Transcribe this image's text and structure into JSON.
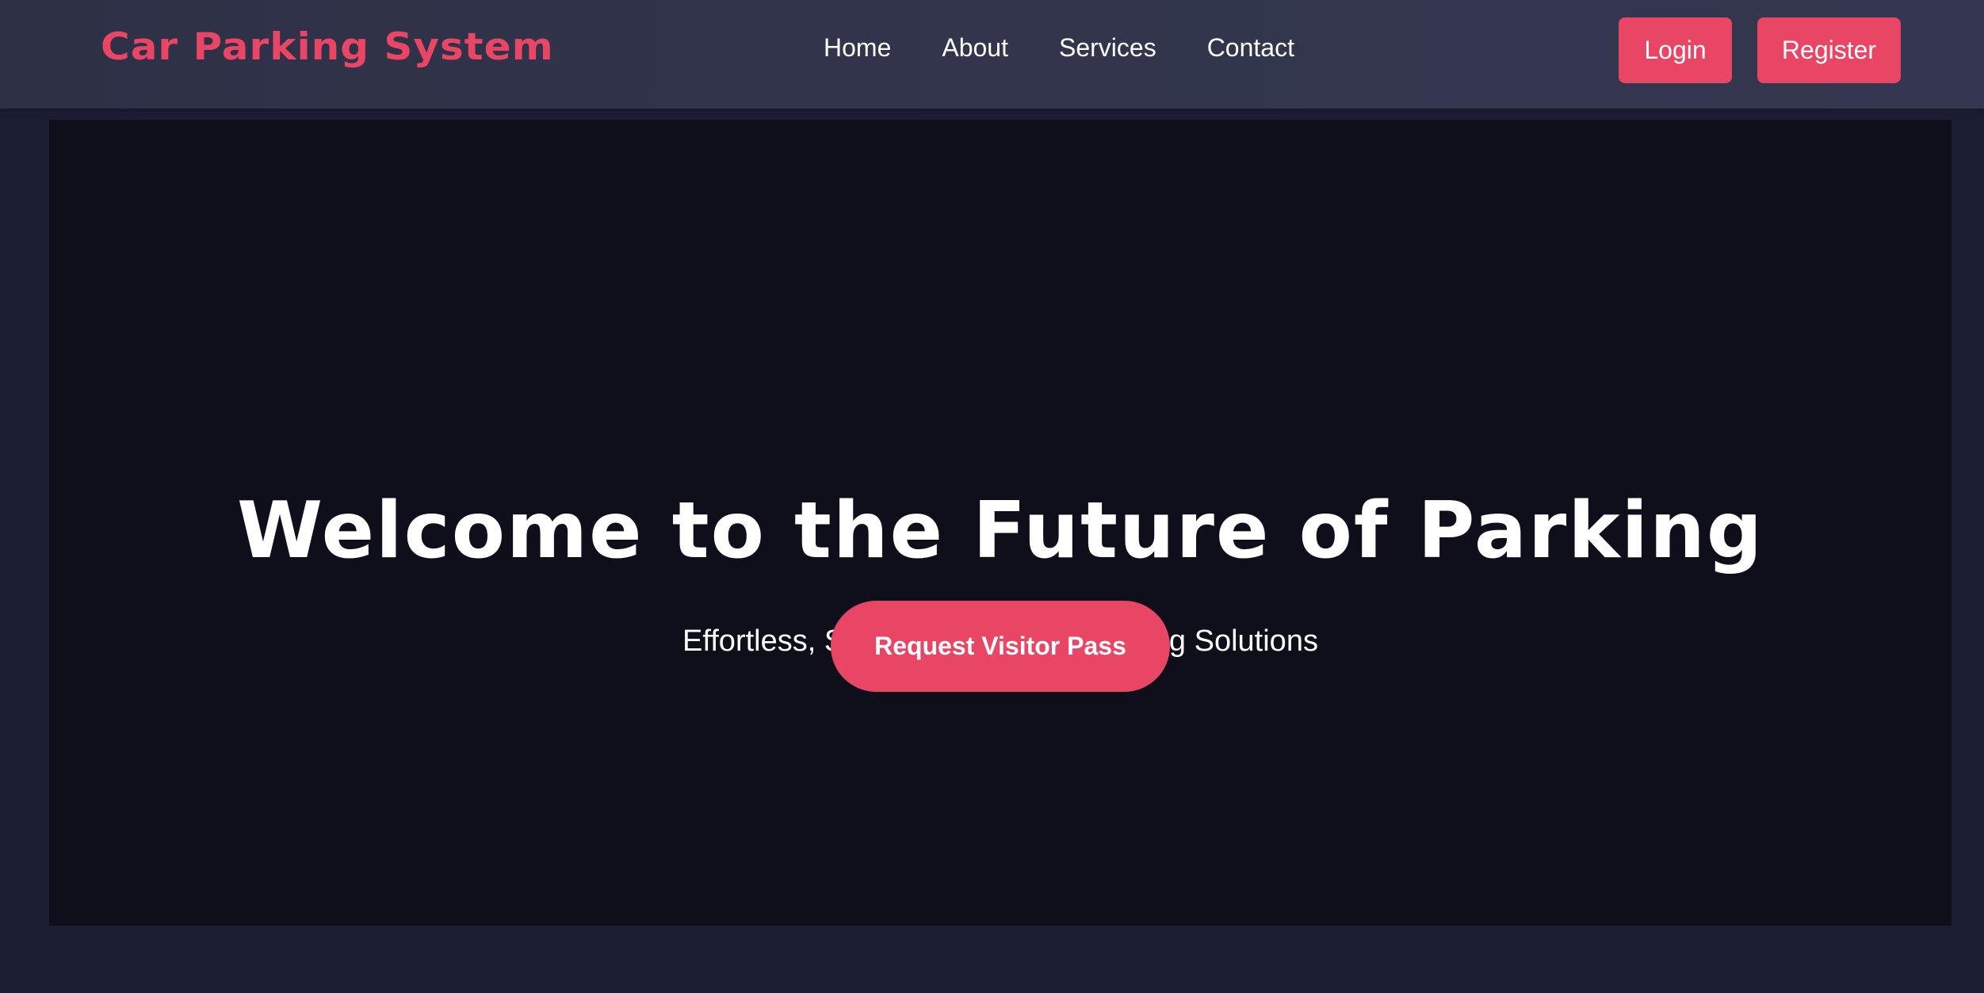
{
  "navbar": {
    "brand": "Car Parking System",
    "links": [
      "Home",
      "About",
      "Services",
      "Contact"
    ],
    "login_label": "Login",
    "register_label": "Register"
  },
  "hero": {
    "title": "Welcome to the Future of Parking",
    "subtitle": "Effortless, Secure, and Smart Parking Solutions",
    "cta_label": "Request Visitor Pass"
  },
  "colors": {
    "accent": "#e84664",
    "navbar": "#32354c",
    "background": "#1b1d33",
    "hero_background": "#0e0f1a",
    "text": "#ffffff"
  }
}
